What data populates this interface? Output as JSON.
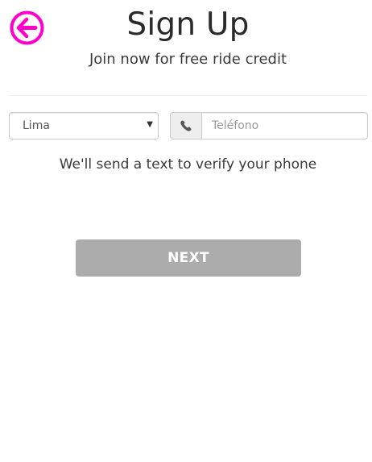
{
  "header": {
    "back_icon": "arrow-left-circle-icon",
    "title": "Sign Up",
    "subtitle": "Join now for free ride credit"
  },
  "form": {
    "country_select": {
      "selected": "Lima"
    },
    "phone": {
      "icon": "phone-icon",
      "placeholder": "Teléfono",
      "value": ""
    },
    "hint": "We'll send a text to verify your phone",
    "next_label": "NEXT"
  },
  "colors": {
    "accent": "#ff00cc",
    "button_disabled": "#acacac",
    "text": "#2b2b2b"
  }
}
